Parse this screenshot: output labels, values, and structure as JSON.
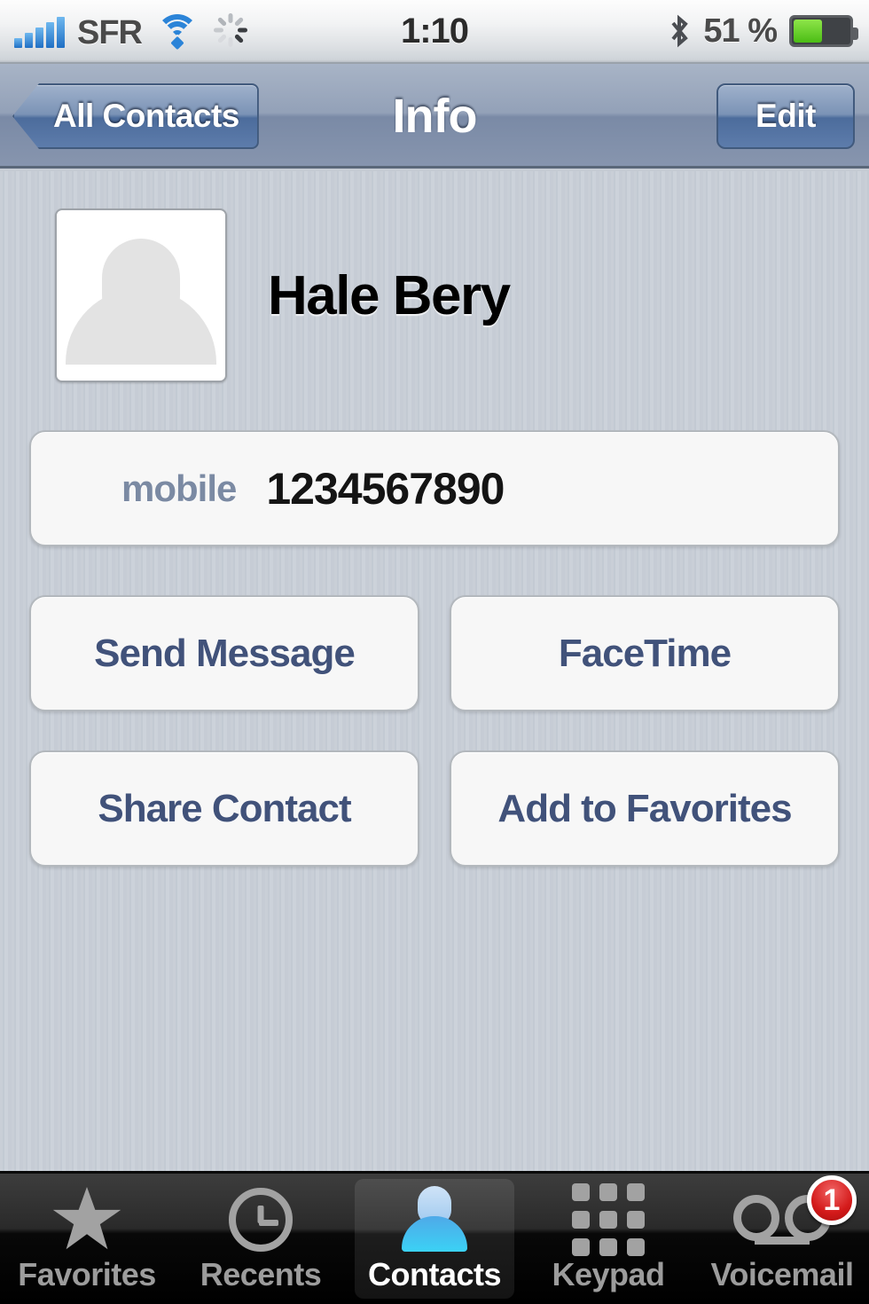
{
  "status_bar": {
    "signal_icon": "signal-bars-icon",
    "signal_bars": 5,
    "carrier": "SFR",
    "wifi_icon": "wifi-icon",
    "activity_icon": "activity-spinner-icon",
    "time": "1:10",
    "bluetooth_icon": "bluetooth-icon",
    "battery_percent": "51 %",
    "battery_level": 51,
    "battery_icon": "battery-icon"
  },
  "nav_bar": {
    "back_label": "All Contacts",
    "title": "Info",
    "edit_label": "Edit"
  },
  "contact": {
    "name": "Hale Bery",
    "avatar_icon": "person-placeholder-icon",
    "phone": {
      "label": "mobile",
      "number": "1234567890"
    }
  },
  "actions": [
    {
      "label": "Send Message"
    },
    {
      "label": "FaceTime"
    },
    {
      "label": "Share Contact"
    },
    {
      "label": "Add to Favorites"
    }
  ],
  "tab_bar": {
    "tabs": [
      {
        "label": "Favorites",
        "icon": "star-icon",
        "selected": false
      },
      {
        "label": "Recents",
        "icon": "clock-icon",
        "selected": false
      },
      {
        "label": "Contacts",
        "icon": "person-icon",
        "selected": true
      },
      {
        "label": "Keypad",
        "icon": "keypad-grid-icon",
        "selected": false
      },
      {
        "label": "Voicemail",
        "icon": "voicemail-icon",
        "selected": false,
        "badge": "1"
      }
    ]
  },
  "colors": {
    "accent_blue": "#41527a",
    "nav_button_blue": "#5d7cab",
    "label_blue": "#7b8aa3",
    "badge_red": "#d41a1a",
    "tab_selected_blue": "#3bd2f5",
    "background_stripe": "#c6ccd5"
  }
}
